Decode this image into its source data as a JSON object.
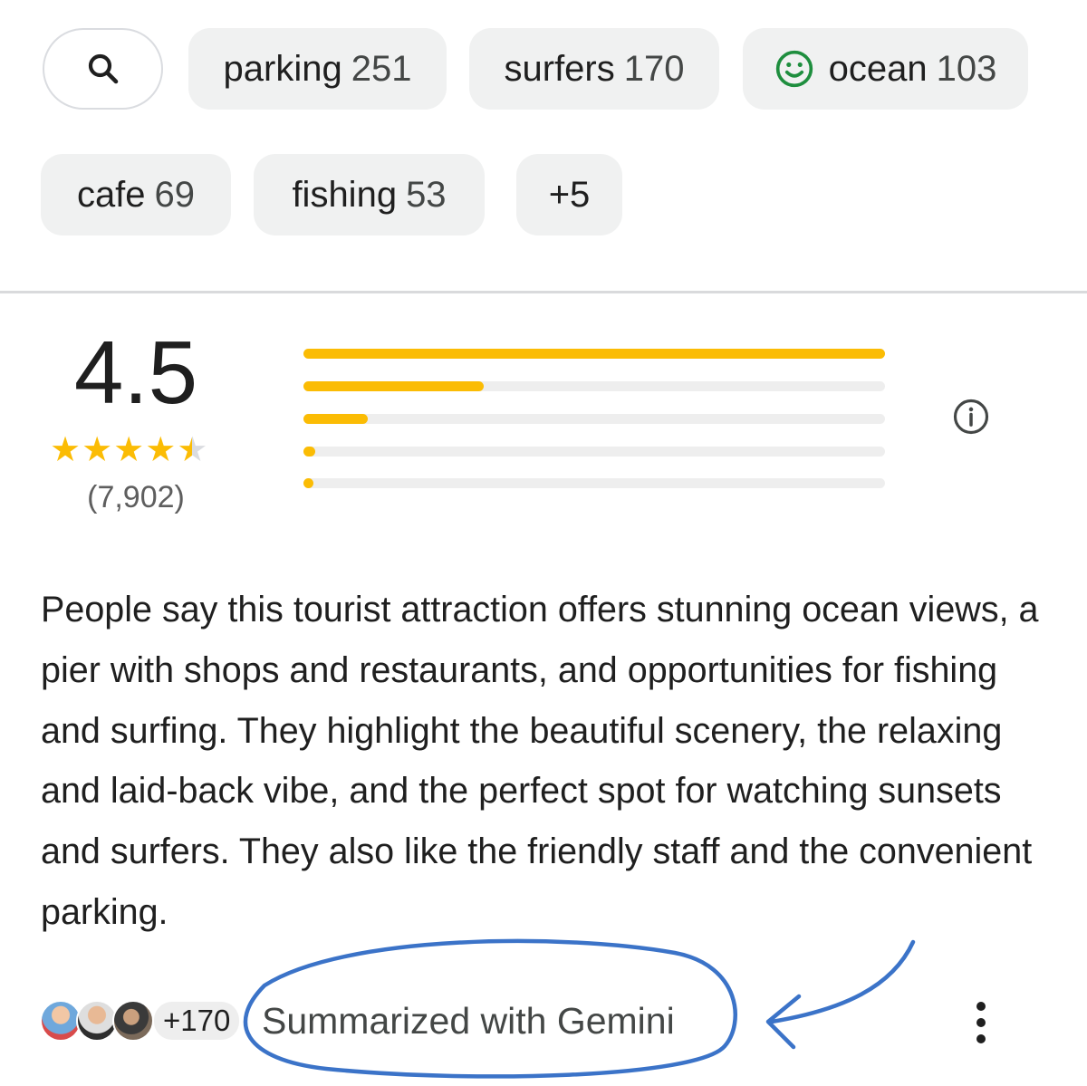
{
  "filters": {
    "chips": [
      {
        "label": "parking",
        "count": "251"
      },
      {
        "label": "surfers",
        "count": "170"
      },
      {
        "label": "ocean",
        "count": "103",
        "icon": "smiley-icon"
      },
      {
        "label": "cafe",
        "count": "69"
      },
      {
        "label": "fishing",
        "count": "53"
      },
      {
        "label": "+5"
      }
    ],
    "search_icon": "search-icon"
  },
  "rating": {
    "value": "4.5",
    "stars": 4.5,
    "star_glyph": "★",
    "review_count": "(7,902)",
    "star_color": "#fbbc04",
    "distribution": [
      {
        "stars": 5,
        "fraction": 1.0
      },
      {
        "stars": 4,
        "fraction": 0.31
      },
      {
        "stars": 3,
        "fraction": 0.11
      },
      {
        "stars": 2,
        "fraction": 0.02
      },
      {
        "stars": 1,
        "fraction": 0.015
      }
    ],
    "bar_color": "#fbbc04",
    "info_icon": "info-icon"
  },
  "summary": {
    "text": "People say this tourist attraction offers stunning ocean views, a pier with shops and restaurants, and opportunities for fishing and surfing. They highlight the beautiful scenery, the relaxing and laid-back vibe, and the perfect spot for watching sunsets and surfers. They also like the friendly staff and the convenient parking.",
    "contributors_more": "+170",
    "attribution": "Summarized with Gemini",
    "more_icon": "more-vert-icon"
  },
  "annotation": {
    "color": "#3b73c8",
    "shapes": [
      "ellipse-circle",
      "arrow"
    ]
  }
}
